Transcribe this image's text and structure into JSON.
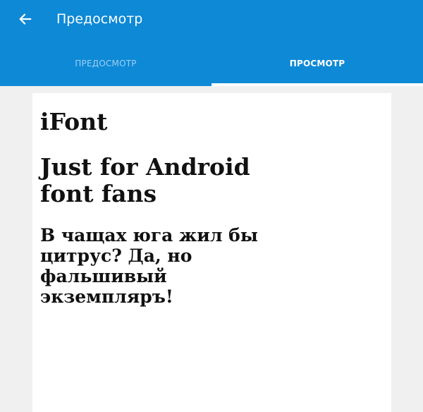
{
  "app_bar": {
    "back_icon": "back-arrow-icon",
    "title": "Предосмотр"
  },
  "tabs": [
    {
      "label": "ПРЕДОСМОТР",
      "selected": false
    },
    {
      "label": "ПРОСМОТР",
      "selected": true
    }
  ],
  "preview": {
    "line_one": "iFont",
    "line_two": "Just for Android\nfont fans",
    "line_three": "В чащах юга жил бы\nцитрус? Да, но\nфальшивый\nэкземпляръ!"
  },
  "colors": {
    "app_bar": "#0d89d6",
    "active_tab": "#ffffff",
    "inactive_tab": "#9ed0f4",
    "background": "#f0f0f0",
    "preview_card": "#ffffff",
    "preview_text": "#111111"
  }
}
